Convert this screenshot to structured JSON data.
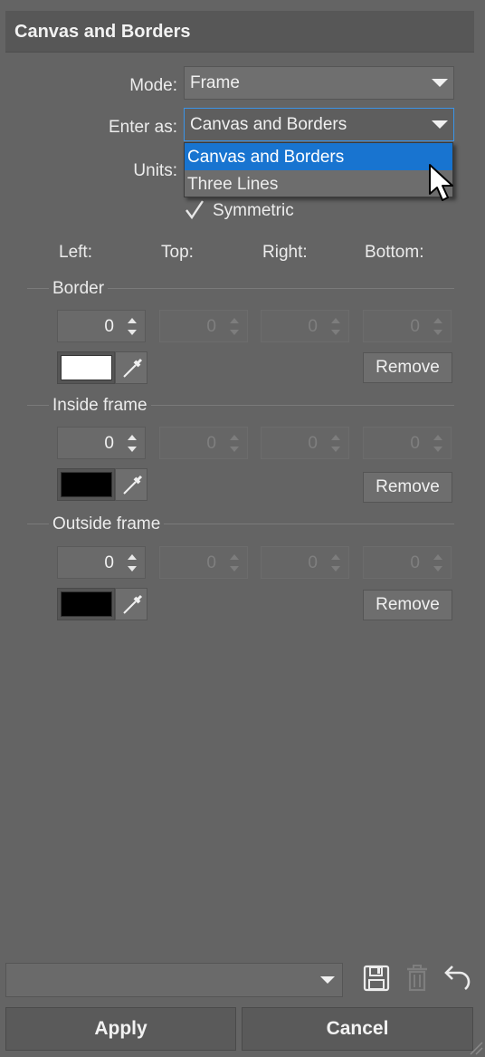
{
  "header": {
    "title": "Canvas and Borders"
  },
  "mode": {
    "label": "Mode:",
    "value": "Frame"
  },
  "enter_as": {
    "label": "Enter as:",
    "value": "Canvas and Borders",
    "options": [
      "Canvas and Borders",
      "Three Lines"
    ],
    "selected_option": "Canvas and Borders"
  },
  "units": {
    "label": "Units:"
  },
  "symmetric": {
    "label": "Symmetric",
    "checked": true
  },
  "columns": [
    "Left:",
    "Top:",
    "Right:",
    "Bottom:"
  ],
  "sections": [
    {
      "title": "Border",
      "values": [
        "0",
        "0",
        "0",
        "0"
      ],
      "color": "#ffffff",
      "remove_label": "Remove"
    },
    {
      "title": "Inside frame",
      "values": [
        "0",
        "0",
        "0",
        "0"
      ],
      "color": "#000000",
      "remove_label": "Remove"
    },
    {
      "title": "Outside frame",
      "values": [
        "0",
        "0",
        "0",
        "0"
      ],
      "color": "#000000",
      "remove_label": "Remove"
    }
  ],
  "footer": {
    "preset_value": "",
    "apply_label": "Apply",
    "cancel_label": "Cancel"
  },
  "icons": {
    "checkmark": "checkmark-icon",
    "eyedropper": "eyedropper-icon",
    "save": "save-icon",
    "trash": "trash-icon",
    "undo": "undo-icon",
    "cursor": "cursor-icon",
    "resize": "resize-grip-icon"
  }
}
